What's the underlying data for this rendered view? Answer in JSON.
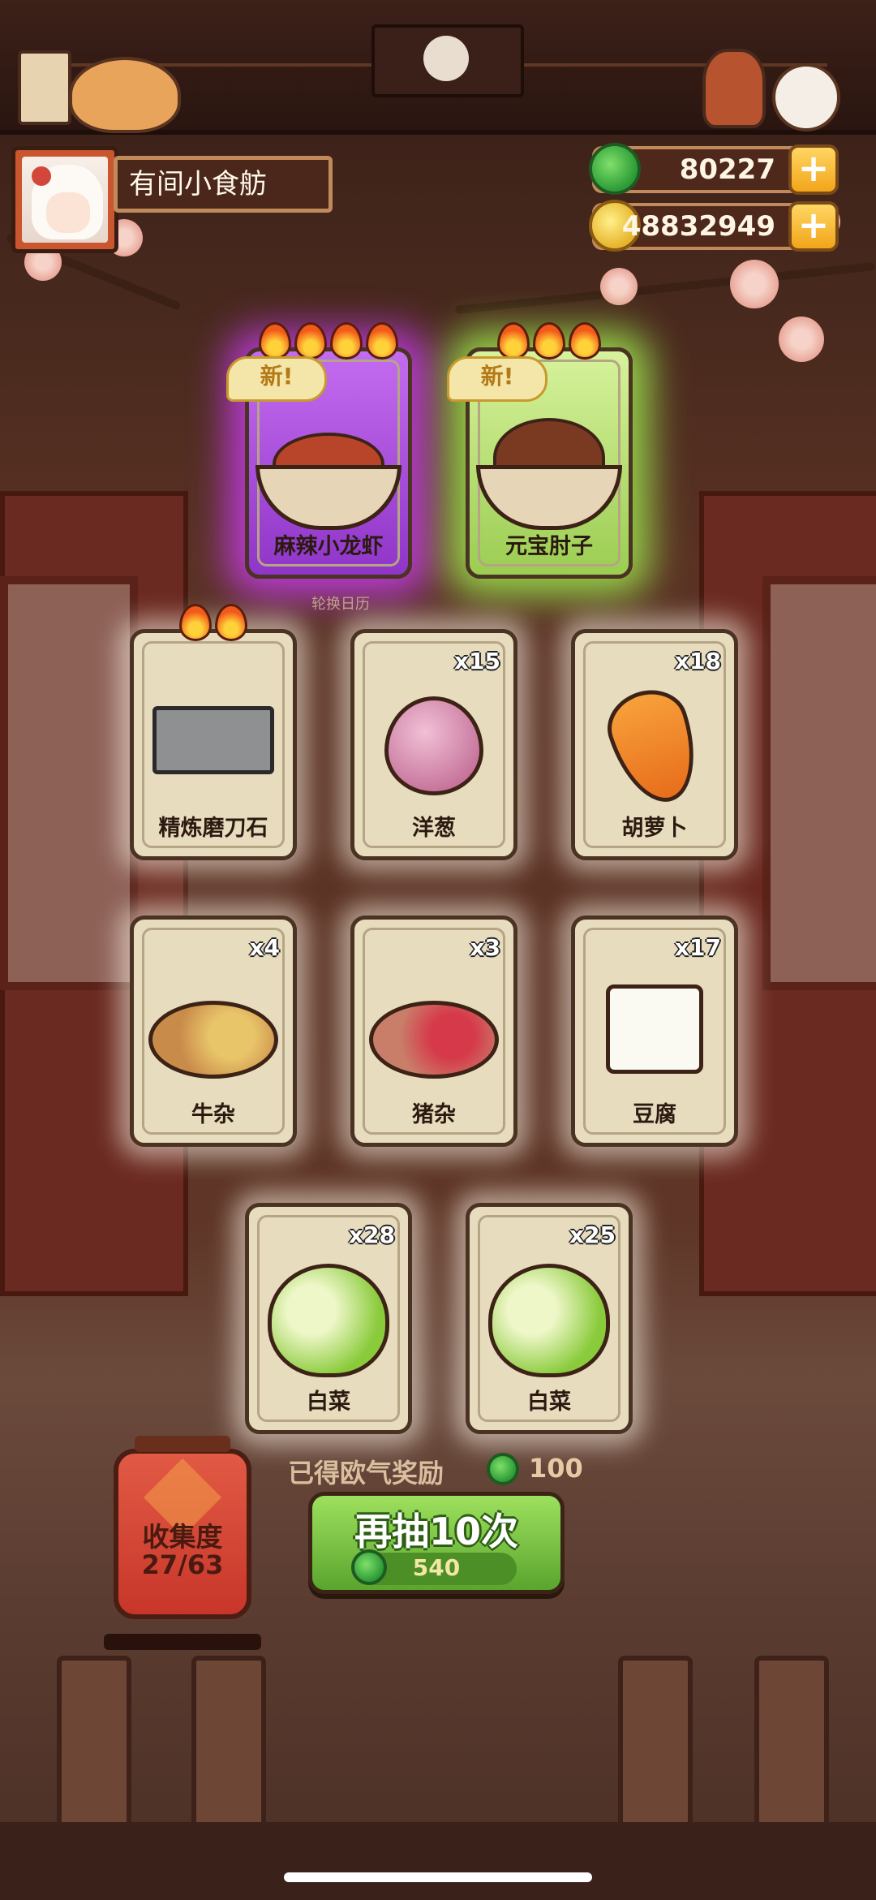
{
  "profile": {
    "shop_name": "有间小食舫"
  },
  "currency": {
    "jade": {
      "icon": "jade-icon",
      "value": "80227",
      "plus": "+"
    },
    "coin": {
      "icon": "coin-icon",
      "value": "48832949",
      "plus": "+"
    }
  },
  "featured": [
    {
      "name": "麻辣小龙虾",
      "tag": "新!",
      "flames": 4,
      "rarity_color": "#b84ae6"
    },
    {
      "name": "元宝肘子",
      "tag": "新!",
      "flames": 3,
      "rarity_color": "#98d64a"
    }
  ],
  "hint": "轮换日历",
  "cards": [
    {
      "name": "精炼磨刀石",
      "qty": "",
      "flames": 2
    },
    {
      "name": "洋葱",
      "qty": "x15"
    },
    {
      "name": "胡萝卜",
      "qty": "x18"
    },
    {
      "name": "牛杂",
      "qty": "x4"
    },
    {
      "name": "猪杂",
      "qty": "x3"
    },
    {
      "name": "豆腐",
      "qty": "x17"
    },
    {
      "name": "白菜",
      "qty": "x28"
    },
    {
      "name": "白菜",
      "qty": "x25"
    }
  ],
  "reward": {
    "label": "已得欧气奖励",
    "value": "100"
  },
  "draw": {
    "label": "再抽10次",
    "cost": "540"
  },
  "collection": {
    "label": "收集度",
    "progress": "27/63"
  }
}
